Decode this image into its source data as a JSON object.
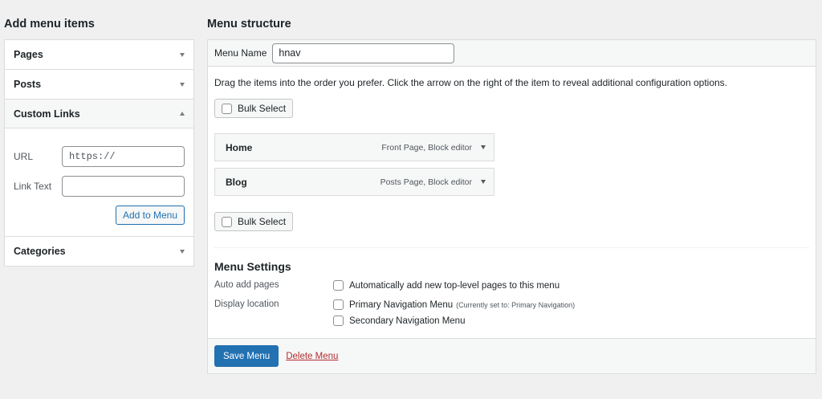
{
  "left": {
    "title": "Add menu items",
    "sections": [
      {
        "label": "Pages"
      },
      {
        "label": "Posts"
      },
      {
        "label": "Custom Links"
      },
      {
        "label": "Categories"
      }
    ],
    "custom_links": {
      "url_label": "URL",
      "url_value": "https://",
      "link_text_label": "Link Text",
      "link_text_value": "",
      "add_button": "Add to Menu"
    }
  },
  "right": {
    "title": "Menu structure",
    "menu_name_label": "Menu Name",
    "menu_name_value": "hnav",
    "instructions": "Drag the items into the order you prefer. Click the arrow on the right of the item to reveal additional configuration options.",
    "bulk_select": "Bulk Select",
    "items": [
      {
        "title": "Home",
        "meta": "Front Page, Block editor"
      },
      {
        "title": "Blog",
        "meta": "Posts Page, Block editor"
      }
    ],
    "settings": {
      "title": "Menu Settings",
      "auto_add_label": "Auto add pages",
      "auto_add_option": "Automatically add new top-level pages to this menu",
      "display_location_label": "Display location",
      "locations": [
        {
          "label": "Primary Navigation Menu",
          "note": "(Currently set to: Primary Navigation)"
        },
        {
          "label": "Secondary Navigation Menu",
          "note": ""
        }
      ]
    },
    "save_button": "Save Menu",
    "delete_link": "Delete Menu"
  }
}
